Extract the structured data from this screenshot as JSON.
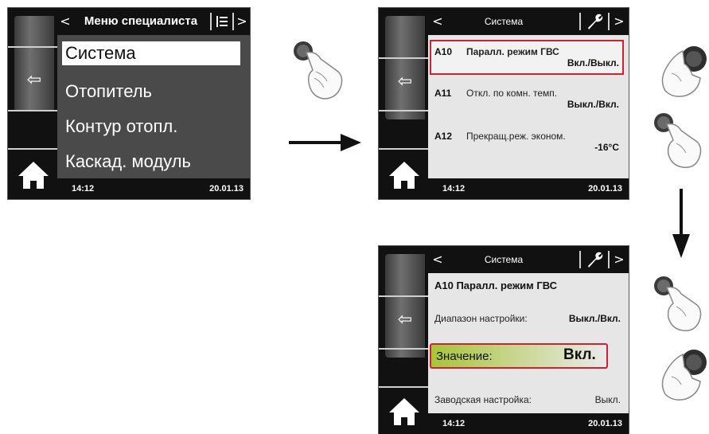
{
  "panel1": {
    "header_title": "Меню специалиста",
    "nav_left": "<",
    "nav_right": ">",
    "menu_items": [
      "Система",
      "Отопитель",
      "Контур отопл.",
      "Каскад. модуль"
    ],
    "time": "14:12",
    "date": "20.01.13"
  },
  "panel2": {
    "header_title": "Система",
    "nav_left": "<",
    "nav_right": ">",
    "params": [
      {
        "code": "A10",
        "name": "Паралл. режим ГВС",
        "value": "Вкл./Выкл."
      },
      {
        "code": "A11",
        "name": "Откл. по комн. темп.",
        "value": "Выкл./Вкл."
      },
      {
        "code": "A12",
        "name": "Прекращ.реж. эконом.",
        "value": "-16°C"
      }
    ],
    "time": "14:12",
    "date": "20.01.13"
  },
  "panel3": {
    "header_title": "Система",
    "nav_left": "<",
    "nav_right": ">",
    "param_title": "A10 Паралл. режим ГВС",
    "range_label": "Диапазон настройки:",
    "range_value": "Выкл./Вкл.",
    "value_label": "Значение:",
    "value_value": "Вкл.",
    "factory_label": "Заводская настройка:",
    "factory_value": "Выкл.",
    "time": "14:12",
    "date": "20.01.13"
  },
  "colors": {
    "selection_border": "#cc2233",
    "value_green": "#a8c43a"
  }
}
